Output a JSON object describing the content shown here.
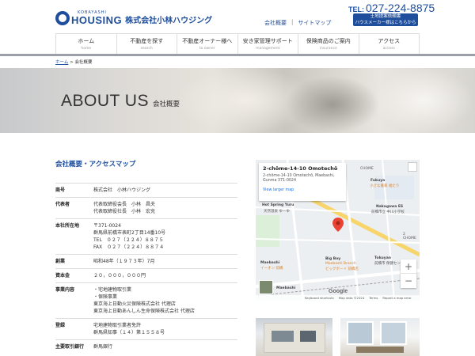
{
  "header": {
    "logo_small": "KOBAYASHI",
    "logo_en": "HOUSING",
    "logo_jp": "株式会社小林ハウジング",
    "links": [
      "会社概要",
      "サイトマップ"
    ],
    "phone_label": "TEL:",
    "phone": "027-224-8875",
    "banner_line1": "土地提案依頼書",
    "banner_line2": "ハウスメーカー様はこちらから"
  },
  "nav": [
    {
      "label": "ホーム",
      "sub": "home"
    },
    {
      "label": "不動産を探す",
      "sub": "search"
    },
    {
      "label": "不動産オーナー様へ",
      "sub": "to owner"
    },
    {
      "label": "安き家管理サポート",
      "sub": "management"
    },
    {
      "label": "保険商品のご案内",
      "sub": "insurance"
    },
    {
      "label": "アクセス",
      "sub": "access"
    }
  ],
  "breadcrumb": {
    "home": "ホーム",
    "sep": ">",
    "current": "会社概要"
  },
  "hero": {
    "title_en": "ABOUT US",
    "title_jp": "会社概要"
  },
  "section": {
    "title": "会社概要・アクセスマップ"
  },
  "company": [
    {
      "label": "商号",
      "lines": [
        "株式会社　小林ハウジング"
      ]
    },
    {
      "label": "代表者",
      "lines": [
        "代表取締役会長　小林　昌夫",
        "代表取締役社長　小林　宏充"
      ]
    },
    {
      "label": "本社所在地",
      "lines": [
        "〒371-0024",
        "群馬県前橋市表町2丁目14番10号",
        "TEL　０２７（２２４）８８７５",
        "FAX　０２７（２２４）８８７４"
      ]
    },
    {
      "label": "創業",
      "lines": [
        "昭和48年（１９７３年）7月"
      ]
    },
    {
      "label": "資本金",
      "lines": [
        "２０，０００，０００円"
      ]
    },
    {
      "label": "事業内容",
      "lines": [
        "・宅地建物取引業",
        "・保険事業",
        "東京海上日動火災保険株式会社 代理店",
        "東京海上日動あんしん生命保険株式会社 代理店"
      ]
    },
    {
      "label": "登録",
      "lines": [
        "宅地建物取引業者免許",
        "群馬県知事（１４）第１５５８号"
      ]
    },
    {
      "label": "主要取引銀行",
      "lines": [
        "群馬銀行"
      ]
    }
  ],
  "map": {
    "card_title": "2-chōme-14-10 Omotechō",
    "card_addr1": "2-chōme-14-10 Omotechō, Maebashi,",
    "card_addr2": "Gunma 371-0024",
    "card_link": "View larger map",
    "labels": [
      "CHOME",
      "Fukuya",
      "小さな書家 福たり",
      "Nakagawa ES",
      "前橋市立 中川小学校",
      "Hot Spring Yuru",
      "天然温泉 ゆーゆ",
      "2 CHOME",
      "Maebashi",
      "イーオン 前橋",
      "Big Boy",
      "Maebashi Branch",
      "ビッグボーイ 前橋店",
      "Tokuyan",
      "前橋市 保健センター",
      "Maebashi"
    ],
    "zoom_in": "+",
    "zoom_out": "−",
    "google": "Google",
    "footer": [
      "Keyboard shortcuts",
      "Map data ©2024",
      "Terms",
      "Report a map error"
    ]
  },
  "colors": {
    "brand": "#1f4e9c",
    "nav_bar": "#9aa0a6",
    "map_pin": "#ea4335"
  }
}
